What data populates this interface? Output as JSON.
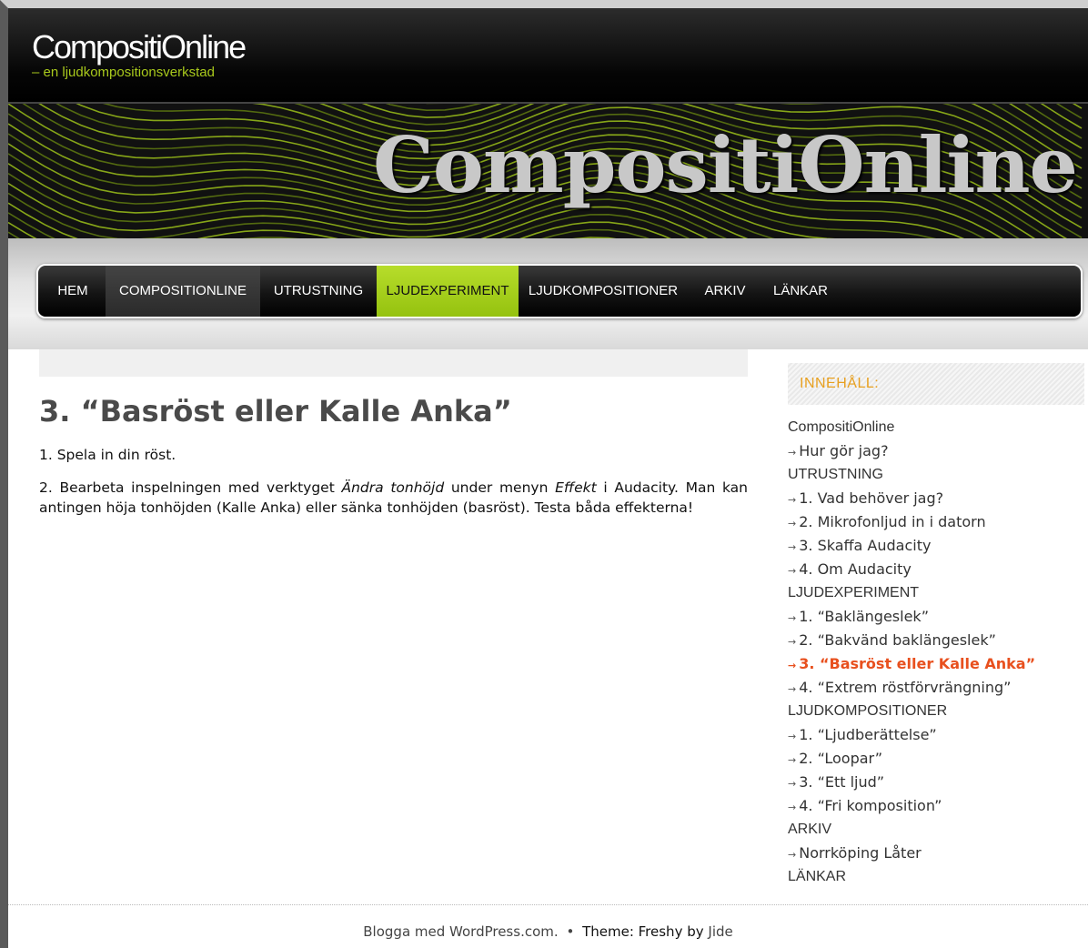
{
  "header": {
    "site_title": "CompositiOnline",
    "tagline": "– en ljudkompositionsverkstad",
    "banner_title": "CompositiOnline",
    "accent_color": "#a8c81c"
  },
  "nav": {
    "items": [
      {
        "label": "HEM"
      },
      {
        "label": "COMPOSITIONLINE"
      },
      {
        "label": "UTRUSTNING"
      },
      {
        "label": "LJUDEXPERIMENT"
      },
      {
        "label": "LJUDKOMPOSITIONER"
      },
      {
        "label": "ARKIV"
      },
      {
        "label": "LÄNKAR"
      }
    ],
    "active": "LJUDEXPERIMENT",
    "active_color": "#a6d01e"
  },
  "post": {
    "title": "3. “Basröst eller Kalle Anka”",
    "p1": "1. Spela in din röst.",
    "p2_a": "2. Bearbeta inspelningen med verktyget ",
    "p2_em1": "Ändra tonhöjd",
    "p2_b": " under menyn ",
    "p2_em2": "Effekt",
    "p2_c": " i Audacity. Man kan antingen höja tonhöjden (Kalle Anka) eller sänka tonhöjden (basröst). Testa båda effekterna!"
  },
  "sidebar": {
    "heading": "INNEHÅLL:",
    "arrow": "→",
    "items": [
      {
        "text": "CompositiOnline",
        "type": "cat"
      },
      {
        "text": "Hur gör jag?",
        "type": "sub"
      },
      {
        "text": "UTRUSTNING",
        "type": "cat"
      },
      {
        "text": "1. Vad behöver jag?",
        "type": "sub"
      },
      {
        "text": "2. Mikrofonljud in i datorn",
        "type": "sub"
      },
      {
        "text": "3. Skaffa Audacity",
        "type": "sub"
      },
      {
        "text": "4. Om Audacity",
        "type": "sub"
      },
      {
        "text": "LJUDEXPERIMENT",
        "type": "cat"
      },
      {
        "text": "1. “Baklängeslek”",
        "type": "sub"
      },
      {
        "text": "2. “Bakvänd baklängeslek”",
        "type": "sub"
      },
      {
        "text": "3. “Basröst eller Kalle Anka”",
        "type": "current"
      },
      {
        "text": "4. “Extrem röstförvrängning”",
        "type": "sub"
      },
      {
        "text": "LJUDKOMPOSITIONER",
        "type": "cat"
      },
      {
        "text": "1. “Ljudberättelse”",
        "type": "sub"
      },
      {
        "text": "2. “Loopar”",
        "type": "sub"
      },
      {
        "text": "3. “Ett ljud”",
        "type": "sub"
      },
      {
        "text": "4. “Fri komposition”",
        "type": "sub"
      },
      {
        "text": "ARKIV",
        "type": "cat"
      },
      {
        "text": "Norrköping Låter",
        "type": "sub"
      },
      {
        "text": "LÄNKAR",
        "type": "cat"
      }
    ],
    "current_color": "#e8501e",
    "heading_color": "#e8a020"
  },
  "footer": {
    "blog_link": "Blogga med WordPress.com",
    "period": ".",
    "bullet": "•",
    "theme_text": "Theme: Freshy by",
    "author_link": "Jide"
  }
}
